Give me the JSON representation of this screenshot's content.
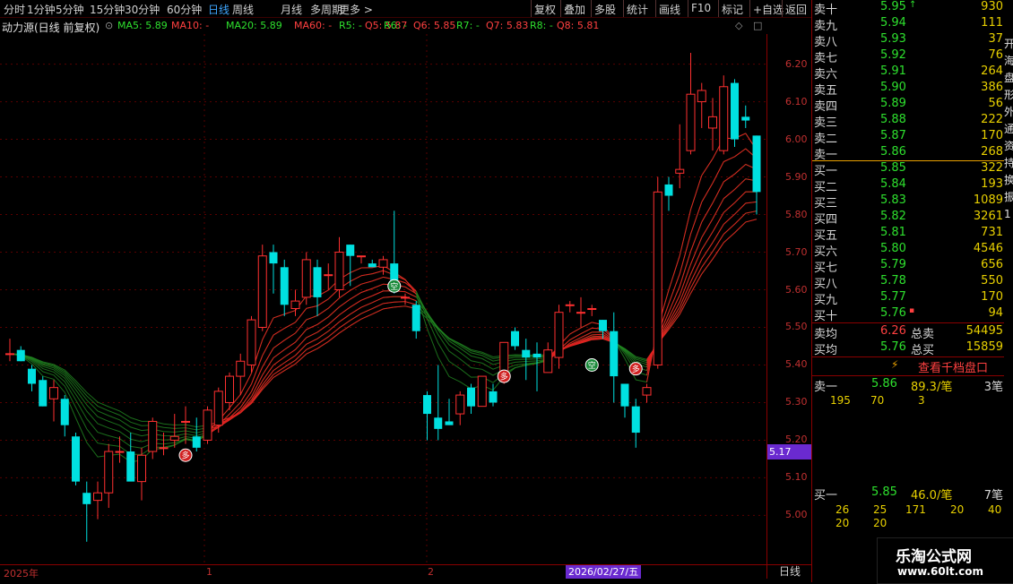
{
  "toolbar": {
    "items": [
      "分时",
      "1分钟",
      "5分钟",
      "15分钟",
      "30分钟",
      "60分钟",
      "日线",
      "周线",
      "月线",
      "多周期",
      "更多 >"
    ],
    "active_index": 6,
    "right_items": [
      "复权",
      "叠加",
      "多股",
      "统计",
      "画线",
      "F10",
      "标记",
      "+自选",
      "返回"
    ]
  },
  "indicator": {
    "title": "动力源(日线 前复权)",
    "ma": [
      {
        "label": "MA5: 5.89",
        "color": "#2ee02e"
      },
      {
        "label": "MA10: -",
        "color": "#ff4040"
      },
      {
        "label": "MA20: 5.89",
        "color": "#2ee02e"
      },
      {
        "label": "MA60: -",
        "color": "#ff4040"
      },
      {
        "label": "R5: -",
        "color": "#2ee02e"
      },
      {
        "label": "Q5: 5.87",
        "color": "#ff4040"
      },
      {
        "label": "R6: -",
        "color": "#2ee02e"
      },
      {
        "label": "Q6: 5.85",
        "color": "#ff4040"
      },
      {
        "label": "R7: -",
        "color": "#2ee02e"
      },
      {
        "label": "Q7: 5.83",
        "color": "#ff4040"
      },
      {
        "label": "R8: -",
        "color": "#2ee02e"
      },
      {
        "label": "Q8: 5.81",
        "color": "#ff4040"
      }
    ]
  },
  "price_axis": {
    "ticks": [
      "6.20",
      "6.10",
      "6.00",
      "5.90",
      "5.80",
      "5.70",
      "5.60",
      "5.50",
      "5.40",
      "5.30",
      "5.20",
      "5.10",
      "5.00"
    ],
    "last_price": "5.17"
  },
  "date_axis": {
    "labels": [
      "2025年",
      "1",
      "2"
    ],
    "selected_date": "2026/02/27/五",
    "period": "日线"
  },
  "signals": {
    "buy_label": "多",
    "sell_label": "空"
  },
  "order_book": {
    "asks": [
      {
        "label": "卖十",
        "price": "5.95",
        "vol": "930",
        "mark": "↑"
      },
      {
        "label": "卖九",
        "price": "5.94",
        "vol": "111"
      },
      {
        "label": "卖八",
        "price": "5.93",
        "vol": "37"
      },
      {
        "label": "卖七",
        "price": "5.92",
        "vol": "76"
      },
      {
        "label": "卖六",
        "price": "5.91",
        "vol": "264"
      },
      {
        "label": "卖五",
        "price": "5.90",
        "vol": "386"
      },
      {
        "label": "卖四",
        "price": "5.89",
        "vol": "56"
      },
      {
        "label": "卖三",
        "price": "5.88",
        "vol": "222"
      },
      {
        "label": "卖二",
        "price": "5.87",
        "vol": "170"
      },
      {
        "label": "卖一",
        "price": "5.86",
        "vol": "268"
      }
    ],
    "bids": [
      {
        "label": "买一",
        "price": "5.85",
        "vol": "322"
      },
      {
        "label": "买二",
        "price": "5.84",
        "vol": "193"
      },
      {
        "label": "买三",
        "price": "5.83",
        "vol": "1089"
      },
      {
        "label": "买四",
        "price": "5.82",
        "vol": "3261"
      },
      {
        "label": "买五",
        "price": "5.81",
        "vol": "731"
      },
      {
        "label": "买六",
        "price": "5.80",
        "vol": "4546"
      },
      {
        "label": "买七",
        "price": "5.79",
        "vol": "656"
      },
      {
        "label": "买八",
        "price": "5.78",
        "vol": "550"
      },
      {
        "label": "买九",
        "price": "5.77",
        "vol": "170"
      },
      {
        "label": "买十",
        "price": "5.76",
        "vol": "94",
        "mark": "▪"
      }
    ],
    "avg_sell": {
      "label": "卖均",
      "price": "6.26",
      "total_label": "总卖",
      "total": "54495"
    },
    "avg_buy": {
      "label": "买均",
      "price": "5.76",
      "total_label": "总买",
      "total": "15859"
    },
    "depth_button": "查看千档盘口",
    "sell1_detail": {
      "label": "卖一",
      "price": "5.86",
      "amount": "89.3/笔",
      "count": "3笔",
      "queue": [
        "195",
        "70",
        "3"
      ]
    },
    "buy1_detail": {
      "label": "买一",
      "price": "5.85",
      "amount": "46.0/笔",
      "count": "7笔",
      "queue": [
        "26",
        "25",
        "171",
        "20",
        "40",
        "20",
        "20"
      ]
    }
  },
  "side_strip": [
    "开",
    "海",
    "盘",
    "形",
    "外",
    "通",
    "资",
    "持",
    "换",
    "振",
    "1"
  ],
  "watermark": {
    "title": "乐淘公式网",
    "url": "www.60lt.com"
  },
  "chart_data": {
    "type": "candlestick",
    "price_range": [
      4.87,
      6.28
    ],
    "candles": [
      {
        "o": 5.43,
        "h": 5.47,
        "l": 5.41,
        "c": 5.43,
        "up": true
      },
      {
        "o": 5.44,
        "h": 5.45,
        "l": 5.41,
        "c": 5.41,
        "up": false
      },
      {
        "o": 5.39,
        "h": 5.4,
        "l": 5.33,
        "c": 5.35,
        "up": false
      },
      {
        "o": 5.36,
        "h": 5.37,
        "l": 5.29,
        "c": 5.29,
        "up": false
      },
      {
        "o": 5.31,
        "h": 5.36,
        "l": 5.25,
        "c": 5.34,
        "up": true
      },
      {
        "o": 5.31,
        "h": 5.32,
        "l": 5.21,
        "c": 5.24,
        "up": false
      },
      {
        "o": 5.21,
        "h": 5.22,
        "l": 5.08,
        "c": 5.09,
        "up": false
      },
      {
        "o": 5.06,
        "h": 5.09,
        "l": 4.93,
        "c": 5.03,
        "up": false
      },
      {
        "o": 5.04,
        "h": 5.09,
        "l": 4.99,
        "c": 5.06,
        "up": true
      },
      {
        "o": 5.06,
        "h": 5.19,
        "l": 5.02,
        "c": 5.17,
        "up": true
      },
      {
        "o": 5.17,
        "h": 5.21,
        "l": 5.14,
        "c": 5.17,
        "up": true
      },
      {
        "o": 5.17,
        "h": 5.22,
        "l": 5.11,
        "c": 5.09,
        "up": false
      },
      {
        "o": 5.09,
        "h": 5.18,
        "l": 5.04,
        "c": 5.16,
        "up": true
      },
      {
        "o": 5.17,
        "h": 5.26,
        "l": 5.15,
        "c": 5.25,
        "up": true
      },
      {
        "o": 5.18,
        "h": 5.22,
        "l": 5.16,
        "c": 5.18,
        "up": true
      },
      {
        "o": 5.2,
        "h": 5.27,
        "l": 5.18,
        "c": 5.21,
        "up": true
      },
      {
        "o": 5.25,
        "h": 5.29,
        "l": 5.19,
        "c": 5.25,
        "up": false
      },
      {
        "o": 5.21,
        "h": 5.26,
        "l": 5.17,
        "c": 5.18,
        "up": false
      },
      {
        "o": 5.2,
        "h": 5.29,
        "l": 5.19,
        "c": 5.28,
        "up": true
      },
      {
        "o": 5.24,
        "h": 5.34,
        "l": 5.22,
        "c": 5.33,
        "up": true
      },
      {
        "o": 5.3,
        "h": 5.38,
        "l": 5.28,
        "c": 5.37,
        "up": true
      },
      {
        "o": 5.37,
        "h": 5.43,
        "l": 5.32,
        "c": 5.41,
        "up": true
      },
      {
        "o": 5.4,
        "h": 5.53,
        "l": 5.38,
        "c": 5.52,
        "up": true
      },
      {
        "o": 5.5,
        "h": 5.72,
        "l": 5.49,
        "c": 5.69,
        "up": true
      },
      {
        "o": 5.7,
        "h": 5.72,
        "l": 5.59,
        "c": 5.67,
        "up": false
      },
      {
        "o": 5.66,
        "h": 5.68,
        "l": 5.53,
        "c": 5.56,
        "up": false
      },
      {
        "o": 5.55,
        "h": 5.6,
        "l": 5.53,
        "c": 5.57,
        "up": true
      },
      {
        "o": 5.58,
        "h": 5.7,
        "l": 5.56,
        "c": 5.68,
        "up": true
      },
      {
        "o": 5.66,
        "h": 5.68,
        "l": 5.53,
        "c": 5.58,
        "up": true
      },
      {
        "o": 5.64,
        "h": 5.67,
        "l": 5.6,
        "c": 5.64,
        "up": false
      },
      {
        "o": 5.6,
        "h": 5.74,
        "l": 5.58,
        "c": 5.7,
        "up": true
      },
      {
        "o": 5.72,
        "h": 5.72,
        "l": 5.61,
        "c": 5.69,
        "up": true
      },
      {
        "o": 5.69,
        "h": 5.69,
        "l": 5.67,
        "c": 5.69,
        "up": false
      },
      {
        "o": 5.67,
        "h": 5.68,
        "l": 5.66,
        "c": 5.66,
        "up": true
      },
      {
        "o": 5.66,
        "h": 5.69,
        "l": 5.64,
        "c": 5.68,
        "up": true
      },
      {
        "o": 5.67,
        "h": 5.81,
        "l": 5.59,
        "c": 5.6,
        "up": false
      },
      {
        "o": 5.58,
        "h": 5.59,
        "l": 5.56,
        "c": 5.58,
        "up": false
      },
      {
        "o": 5.56,
        "h": 5.57,
        "l": 5.47,
        "c": 5.49,
        "up": false
      },
      {
        "o": 5.32,
        "h": 5.33,
        "l": 5.2,
        "c": 5.27,
        "up": false
      },
      {
        "o": 5.26,
        "h": 5.4,
        "l": 5.2,
        "c": 5.23,
        "up": false
      },
      {
        "o": 5.25,
        "h": 5.31,
        "l": 5.24,
        "c": 5.24,
        "up": true
      },
      {
        "o": 5.27,
        "h": 5.33,
        "l": 5.24,
        "c": 5.32,
        "up": true
      },
      {
        "o": 5.34,
        "h": 5.35,
        "l": 5.27,
        "c": 5.29,
        "up": false
      },
      {
        "o": 5.29,
        "h": 5.37,
        "l": 5.29,
        "c": 5.37,
        "up": false
      },
      {
        "o": 5.33,
        "h": 5.35,
        "l": 5.29,
        "c": 5.3,
        "up": true
      },
      {
        "o": 5.38,
        "h": 5.46,
        "l": 5.35,
        "c": 5.46,
        "up": true
      },
      {
        "o": 5.49,
        "h": 5.5,
        "l": 5.44,
        "c": 5.45,
        "up": false
      },
      {
        "o": 5.44,
        "h": 5.47,
        "l": 5.36,
        "c": 5.42,
        "up": true
      },
      {
        "o": 5.43,
        "h": 5.46,
        "l": 5.33,
        "c": 5.42,
        "up": false
      },
      {
        "o": 5.38,
        "h": 5.46,
        "l": 5.38,
        "c": 5.44,
        "up": true
      },
      {
        "o": 5.42,
        "h": 5.56,
        "l": 5.39,
        "c": 5.54,
        "up": true
      },
      {
        "o": 5.56,
        "h": 5.57,
        "l": 5.54,
        "c": 5.56,
        "up": true
      },
      {
        "o": 5.54,
        "h": 5.58,
        "l": 5.5,
        "c": 5.54,
        "up": true
      },
      {
        "o": 5.55,
        "h": 5.56,
        "l": 5.53,
        "c": 5.55,
        "up": false
      },
      {
        "o": 5.52,
        "h": 5.52,
        "l": 5.47,
        "c": 5.49,
        "up": false
      },
      {
        "o": 5.49,
        "h": 5.54,
        "l": 5.3,
        "c": 5.37,
        "up": false
      },
      {
        "o": 5.35,
        "h": 5.35,
        "l": 5.26,
        "c": 5.29,
        "up": false
      },
      {
        "o": 5.29,
        "h": 5.31,
        "l": 5.18,
        "c": 5.22,
        "up": true
      },
      {
        "o": 5.32,
        "h": 5.35,
        "l": 5.3,
        "c": 5.34,
        "up": true
      },
      {
        "o": 5.4,
        "h": 5.9,
        "l": 5.39,
        "c": 5.86,
        "up": true
      },
      {
        "o": 5.88,
        "h": 5.9,
        "l": 5.81,
        "c": 5.85,
        "up": true
      },
      {
        "o": 5.91,
        "h": 6.04,
        "l": 5.87,
        "c": 5.92,
        "up": true
      },
      {
        "o": 5.97,
        "h": 6.23,
        "l": 5.96,
        "c": 6.12,
        "up": true
      },
      {
        "o": 6.1,
        "h": 6.15,
        "l": 6.03,
        "c": 6.13,
        "up": true
      },
      {
        "o": 6.03,
        "h": 6.11,
        "l": 5.97,
        "c": 6.06,
        "up": false
      },
      {
        "o": 5.97,
        "h": 6.17,
        "l": 5.96,
        "c": 6.14,
        "up": true
      },
      {
        "o": 6.15,
        "h": 6.16,
        "l": 5.98,
        "c": 6.0,
        "up": false
      },
      {
        "o": 6.06,
        "h": 6.09,
        "l": 6.03,
        "c": 6.05,
        "up": true
      },
      {
        "o": 6.01,
        "h": 6.01,
        "l": 5.8,
        "c": 5.86,
        "up": false
      }
    ]
  }
}
